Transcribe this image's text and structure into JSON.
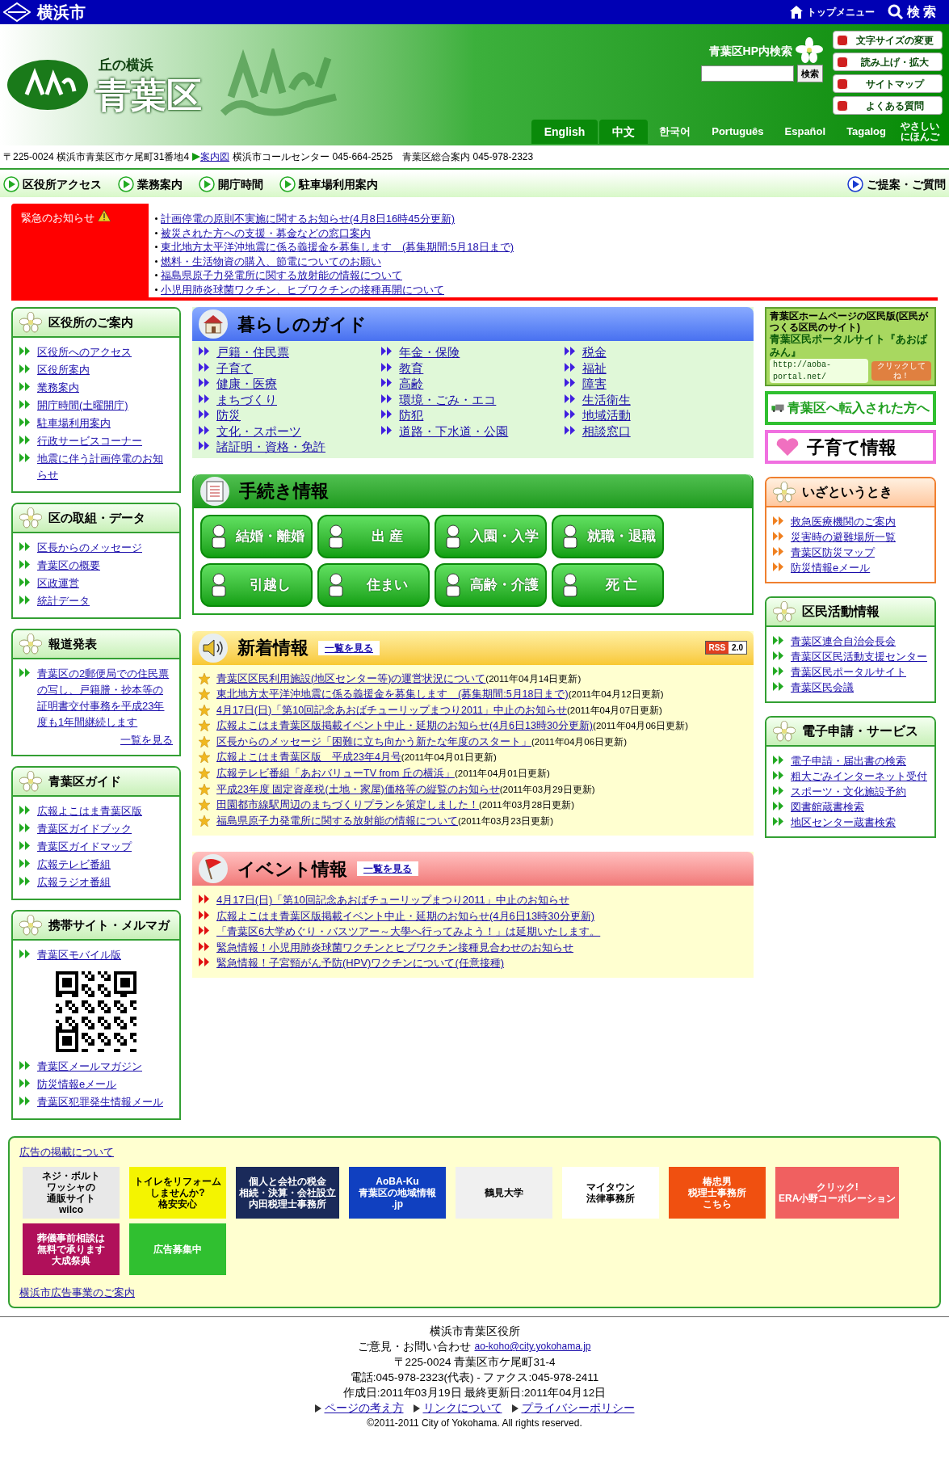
{
  "top_bar": {
    "city": "横浜市",
    "links": [
      {
        "kind": "home",
        "label": "トップメニュー"
      },
      {
        "kind": "search",
        "label": "検 索"
      }
    ]
  },
  "header": {
    "tagline": "丘の横浜",
    "ward": "青葉区",
    "search_label": "青葉区HP内検索",
    "search_button": "検索",
    "tools": [
      "文字サイズの変更",
      "読み上げ・拡大",
      "サイトマップ",
      "よくある質問"
    ],
    "languages": [
      {
        "label": "English",
        "kind": "boxed"
      },
      {
        "label": "中文",
        "kind": "boxed"
      },
      {
        "label": "한국어",
        "kind": "plain"
      },
      {
        "label": "Português",
        "kind": "plain"
      },
      {
        "label": "Español",
        "kind": "plain"
      },
      {
        "label": "Tagalog",
        "kind": "plain"
      },
      {
        "label": "やさしいにほんご",
        "kind": "plain"
      }
    ]
  },
  "address": {
    "before": "〒225-0024 横浜市青葉区市ケ尾町31番地4",
    "link": "案内図",
    "after": "横浜市コールセンター 045-664-2525　青葉区総合案内 045-978-2323"
  },
  "nav": {
    "items": [
      "区役所アクセス",
      "業務案内",
      "開庁時間",
      "駐車場利用案内"
    ],
    "right": "ご提案・ご質問"
  },
  "emergency": {
    "title": "緊急のお知らせ",
    "items": [
      "計画停電の原則不実施に関するお知らせ(4月8日16時45分更新)",
      "被災された方への支援・募金などの窓口案内",
      "東北地方太平洋沖地震に係る義援金を募集します　(募集期間:5月18日まで)",
      "燃料・生活物資の購入、節電についてのお願い",
      "福島県原子力発電所に関する放射能の情報について",
      "小児用肺炎球菌ワクチン、ヒブワクチンの接種再開について"
    ]
  },
  "left_boxes": [
    {
      "title": "区役所のご案内",
      "items": [
        {
          "kind": "link",
          "text": "区役所へのアクセス"
        },
        {
          "kind": "link",
          "text": "区役所案内"
        },
        {
          "kind": "link",
          "text": "業務案内"
        },
        {
          "kind": "link",
          "text": "開庁時間(土曜開庁)"
        },
        {
          "kind": "link",
          "text": "駐車場利用案内"
        },
        {
          "kind": "link",
          "text": "行政サービスコーナー"
        },
        {
          "kind": "link",
          "text": "地震に伴う計画停電のお知らせ"
        }
      ]
    },
    {
      "title": "区の取組・データ",
      "items": [
        {
          "kind": "link",
          "text": "区長からのメッセージ"
        },
        {
          "kind": "link",
          "text": "青葉区の概要"
        },
        {
          "kind": "link",
          "text": "区政運営"
        },
        {
          "kind": "link",
          "text": "統計データ"
        }
      ]
    },
    {
      "title": "報道発表",
      "items": [
        {
          "kind": "link",
          "text": "青葉区の2郵便局での住民票の写し、戸籍謄・抄本等の証明書交付事務を平成23年度も1年間継続します"
        },
        {
          "kind": "more",
          "text": "一覧を見る"
        }
      ]
    },
    {
      "title": "青葉区ガイド",
      "items": [
        {
          "kind": "link",
          "text": "広報よこはま青葉区版"
        },
        {
          "kind": "link",
          "text": "青葉区ガイドブック"
        },
        {
          "kind": "link",
          "text": "青葉区ガイドマップ"
        },
        {
          "kind": "link",
          "text": "広報テレビ番組"
        },
        {
          "kind": "link",
          "text": "広報ラジオ番組"
        }
      ]
    },
    {
      "title": "携帯サイト・メルマガ",
      "items": [
        {
          "kind": "link",
          "text": "青葉区モバイル版"
        },
        {
          "kind": "qr"
        },
        {
          "kind": "link",
          "text": "青葉区メールマガジン"
        },
        {
          "kind": "link",
          "text": "防災情報eメール"
        },
        {
          "kind": "link",
          "text": "青葉区犯罪発生情報メール"
        }
      ]
    }
  ],
  "guide": {
    "title": "暮らしのガイド",
    "columns": [
      [
        "戸籍・住民票",
        "子育て",
        "健康・医療",
        "まちづくり",
        "防災",
        "文化・スポーツ",
        "諸証明・資格・免許"
      ],
      [
        "年金・保険",
        "教育",
        "高齢",
        "環境・ごみ・エコ",
        "防犯",
        "道路・下水道・公園"
      ],
      [
        "税金",
        "福祉",
        "障害",
        "生活衛生",
        "地域活動",
        "相談窓口"
      ]
    ]
  },
  "procedures": {
    "title": "手続き情報",
    "buttons": [
      "結婚・離婚",
      "出 産",
      "入園・入学",
      "就職・退職",
      "引越し",
      "住まい",
      "高齢・介護",
      "死 亡"
    ]
  },
  "news": {
    "title": "新着情報",
    "more": "一覧を見る",
    "rss": "RSS",
    "rss_version": "2.0",
    "items": [
      {
        "title": "青葉区区民利用施設(地区センター等)の運営状況について",
        "date": "(2011年04月14日更新)"
      },
      {
        "title": "東北地方太平洋沖地震に係る義援金を募集します　(募集期間:5月18日まで)",
        "date": "(2011年04月12日更新)"
      },
      {
        "title": "4月17日(日)「第10回記念あおばチューリップまつり2011」中止のお知らせ",
        "date": "(2011年04月07日更新)"
      },
      {
        "title": "広報よこはま青葉区版掲載イベント中止・延期のお知らせ(4月6日13時30分更新)",
        "date": "(2011年04月06日更新)"
      },
      {
        "title": "区長からのメッセージ「困難に立ち向かう新たな年度のスタート」",
        "date": "(2011年04月06日更新)"
      },
      {
        "title": "広報よこはま青葉区版　平成23年4月号",
        "date": "(2011年04月01日更新)"
      },
      {
        "title": "広報テレビ番組「あおバリューTV from 丘の横浜」",
        "date": "(2011年04月01日更新)"
      },
      {
        "title": "平成23年度 固定資産税(土地・家屋)価格等の縦覧のお知らせ",
        "date": "(2011年03月29日更新)"
      },
      {
        "title": "田園都市線駅周辺のまちづくりプランを策定しました！",
        "date": "(2011年03月28日更新)"
      },
      {
        "title": "福島県原子力発電所に関する放射能の情報について",
        "date": "(2011年03月23日更新)"
      }
    ]
  },
  "events": {
    "title": "イベント情報",
    "more": "一覧を見る",
    "items": [
      "4月17日(日)「第10回記念あおばチューリップまつり2011」中止のお知らせ",
      "広報よこはま青葉区版掲載イベント中止・延期のお知らせ(4月6日13時30分更新)",
      "「青葉区6大学めぐり・バスツアー～大學へ行ってみよう！」は延期いたします。",
      "緊急情報！小児用肺炎球菌ワクチンとヒブワクチン接種見合わせのお知らせ",
      "緊急情報！子宮頸がん予防(HPV)ワクチンについて(任意接種)"
    ]
  },
  "right_banners": [
    {
      "kind": "portal",
      "lines": [
        "青葉区ホームページの区民版(区民がつくる区民のサイト)",
        "青葉区民ポータルサイト『あおばみん』",
        "http://aoba-portal.net/",
        "クリックしてね！"
      ]
    },
    {
      "kind": "move",
      "lines": [
        "青葉区へ転入された方へ"
      ]
    },
    {
      "kind": "child",
      "lines": [
        "子育て情報"
      ]
    }
  ],
  "right_boxes": [
    {
      "kind": "orange",
      "title": "いざというとき",
      "items": [
        "救急医療機関のご案内",
        "災害時の避難場所一覧",
        "青葉区防災マップ",
        "防災情報eメール"
      ]
    },
    {
      "kind": "green",
      "title": "区民活動情報",
      "items": [
        "青葉区連合自治会長会",
        "青葉区区民活動支援センター",
        "青葉区民ポータルサイト",
        "青葉区民会議"
      ]
    },
    {
      "kind": "green",
      "title": "電子申請・サービス",
      "items": [
        "電子申請・届出書の検索",
        "粗大ごみインターネット受付",
        "スポーツ・文化施設予約",
        "図書館蔵書検索",
        "地区センター蔵書検索"
      ]
    }
  ],
  "ads": {
    "link": "広告の掲載について",
    "banners": [
      {
        "color": "#e8e8e8",
        "lines": [
          "ネジ・ボルト",
          "ワッシャの",
          "通販サイト",
          "wilco"
        ]
      },
      {
        "color": "#f4f400",
        "lines": [
          "トイレをリフォーム",
          "しませんか?",
          "格安安心"
        ]
      },
      {
        "color": "#1a2a5a",
        "lines": [
          "個人と会社の税金",
          "相続・決算・会社設立",
          "内田税理士事務所"
        ]
      },
      {
        "color": "#1040c0",
        "lines": [
          "AoBA-Ku",
          "青葉区の地域情報",
          ".jp"
        ]
      },
      {
        "color": "#f0f0f0",
        "lines": [
          "鶴見大学"
        ]
      },
      {
        "color": "#ffffff",
        "lines": [
          "マイタウン",
          "法律事務所"
        ]
      },
      {
        "color": "#f05010",
        "lines": [
          "椿忠男",
          "税理士事務所",
          "こちら"
        ]
      },
      {
        "color": "#f06060",
        "lines": [
          "クリック!",
          "ERA小野コーポレーション"
        ]
      },
      {
        "color": "#b0105a",
        "lines": [
          "葬儀事前相談は",
          "無料で承ります",
          "大成祭典"
        ]
      },
      {
        "color": "#30c030",
        "lines": [
          "広告募集中"
        ]
      }
    ],
    "footer_link": "横浜市広告事業のご案内"
  },
  "footer": {
    "office": "横浜市青葉区役所",
    "contact_label": "ご意見・お問い合わせ",
    "email": "ao-koho@city.yokohama.jp",
    "address": "〒225-0024 青葉区市ケ尾町31-4",
    "phone": "電話:045-978-2323(代表) - ファクス:045-978-2411",
    "dates": "作成日:2011年03月19日 最終更新日:2011年04月12日",
    "links": [
      "ページの考え方",
      "リンクについて",
      "プライバシーポリシー"
    ],
    "copyright": "©2011-2011 City of Yokohama. All rights reserved."
  }
}
